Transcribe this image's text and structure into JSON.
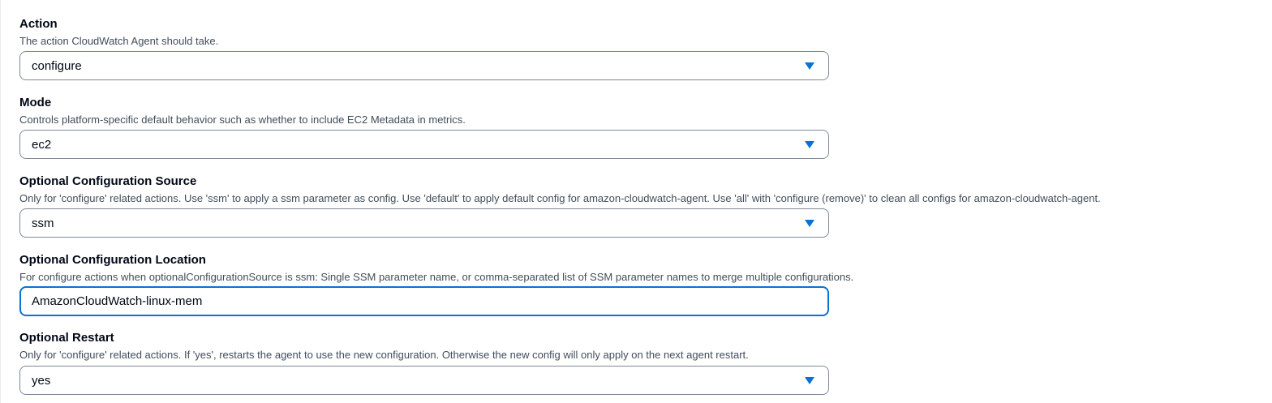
{
  "fields": [
    {
      "label": "Action",
      "description": "The action CloudWatch Agent should take.",
      "value": "configure"
    },
    {
      "label": "Mode",
      "description": "Controls platform-specific default behavior such as whether to include EC2 Metadata in metrics.",
      "value": "ec2"
    },
    {
      "label": "Optional Configuration Source",
      "description": "Only for 'configure' related actions. Use 'ssm' to apply a ssm parameter as config. Use 'default' to apply default config for amazon-cloudwatch-agent. Use 'all' with 'configure (remove)' to clean all configs for amazon-cloudwatch-agent.",
      "value": "ssm"
    },
    {
      "label": "Optional Configuration Location",
      "description": "For configure actions when optionalConfigurationSource is ssm: Single SSM parameter name, or comma-separated list of SSM parameter names to merge multiple configurations.",
      "value": "AmazonCloudWatch-linux-mem"
    },
    {
      "label": "Optional Restart",
      "description": "Only for 'configure' related actions. If 'yes', restarts the agent to use the new configuration. Otherwise the new config will only apply on the next agent restart.",
      "value": "yes"
    }
  ],
  "colors": {
    "focus_border": "#0972d3",
    "caret": "#0972d3",
    "border": "#7d8998",
    "description_text": "#414d5c"
  },
  "icons": {
    "dropdown": "caret-down-icon"
  }
}
